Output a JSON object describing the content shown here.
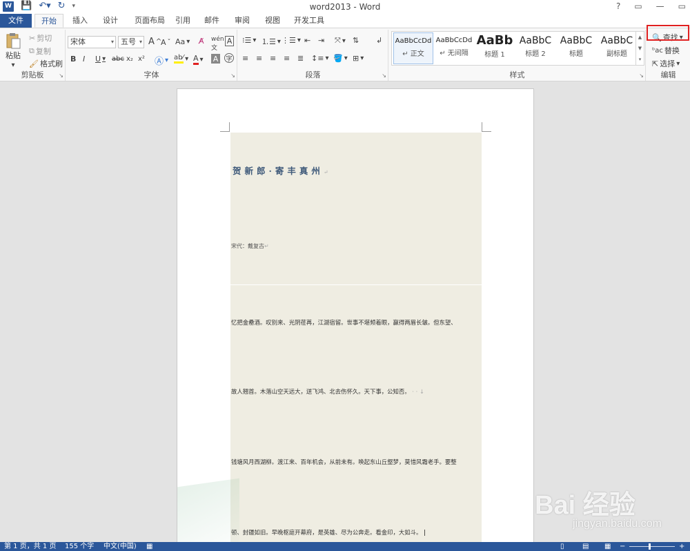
{
  "window": {
    "title": "word2013 - Word",
    "help": "?",
    "minimize": "—",
    "restore": "▭",
    "close": "✕",
    "qat_icons": [
      "word-logo",
      "save-icon",
      "undo-icon",
      "redo-icon",
      "customize-icon"
    ]
  },
  "tabs": [
    "文件",
    "开始",
    "插入",
    "设计",
    "页面布局",
    "引用",
    "邮件",
    "审阅",
    "视图",
    "开发工具"
  ],
  "ribbon": {
    "clipboard": {
      "label": "剪贴板",
      "paste": "粘贴",
      "cut": "剪切",
      "copy": "复制",
      "format_painter": "格式刷"
    },
    "font": {
      "label": "字体",
      "font_name": "宋体",
      "font_size": "五号",
      "grow": "A",
      "shrink": "A",
      "case": "Aa",
      "bold": "B",
      "italic": "I",
      "underline": "U",
      "strikethrough": "abc",
      "subscript": "x₂",
      "superscript": "x²"
    },
    "paragraph": {
      "label": "段落"
    },
    "styles": {
      "label": "样式",
      "items": [
        {
          "preview": "AaBbCcDd",
          "name": "↵ 正文"
        },
        {
          "preview": "AaBbCcDd",
          "name": "↵ 无间隔"
        },
        {
          "preview": "AaBb",
          "name": "标题 1"
        },
        {
          "preview": "AaBbC",
          "name": "标题 2"
        },
        {
          "preview": "AaBbC",
          "name": "标题"
        },
        {
          "preview": "AaBbC",
          "name": "副标题"
        }
      ]
    },
    "editing": {
      "label": "编辑",
      "find": "查找",
      "replace": "替换",
      "select": "选择"
    }
  },
  "document": {
    "title": "贺新郎·寄丰真州",
    "author_line": "宋代：戴复古",
    "lines": [
      "忆把金罍酒。叹别来、光阴荏苒，江湖宿留。世事不堪频着眼，赢得两眉长皱。但东望、",
      "故人翘首。木落山空天远大，送飞鸿、北去伤怀久。天下事，公知否。",
      "钱塘风月西湖柳。渡江来、百年机会，从前未有。唤起东山丘壑梦，莫惜风霜老手。要整",
      "顿、封疆如旧。早晚枢庭开幕府，是英雄、尽为公奔走。看金印，大如斗。"
    ]
  },
  "statusbar": {
    "page": "第 1 页，共 1 页",
    "words": "155 个字",
    "language": "中文(中国)"
  },
  "watermark": {
    "brand": "Bai  经验",
    "url": "jingyan.baidu.com"
  },
  "colors": {
    "accent": "#2b579a",
    "highlight_box": "#e02020",
    "page_shading": "#efede2",
    "title_text": "#3f5a7a"
  }
}
